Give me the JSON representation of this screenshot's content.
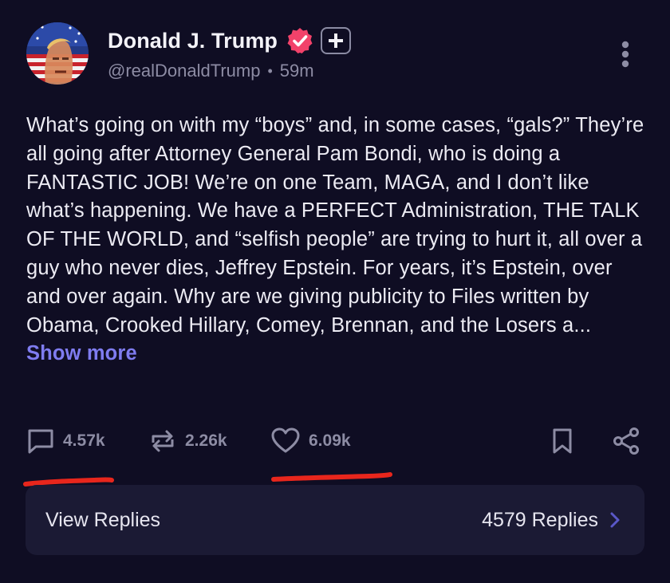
{
  "post": {
    "author": {
      "display_name": "Donald J. Trump",
      "handle": "@realDonaldTrump",
      "time_ago": "59m",
      "badges": [
        "verified-icon",
        "truth-plus-icon"
      ]
    },
    "body": "What’s going on with my “boys” and, in some cases, “gals?” They’re all going after Attorney General Pam Bondi, who is doing a FANTASTIC JOB! We’re on one Team, MAGA, and I don’t like what’s happening. We have a PERFECT Administration, THE TALK OF THE WORLD, and “selfish people” are trying to hurt it, all over a guy who never dies, Jeffrey Epstein. For years, it’s Epstein, over and over again. Why are we giving publicity to Files written by Obama, Crooked Hillary, Comey, Brennan, and the Losers a...",
    "show_more_label": "Show more",
    "actions": {
      "replies": "4.57k",
      "retruths": "2.26k",
      "likes": "6.09k"
    },
    "replies_bar": {
      "label": "View Replies",
      "count_label": "4579 Replies"
    }
  },
  "colors": {
    "background": "#0f0d23",
    "card": "#1b1a34",
    "accent": "#7f7cf0",
    "verified": "#f2426a",
    "annotation": "#e8261c"
  }
}
